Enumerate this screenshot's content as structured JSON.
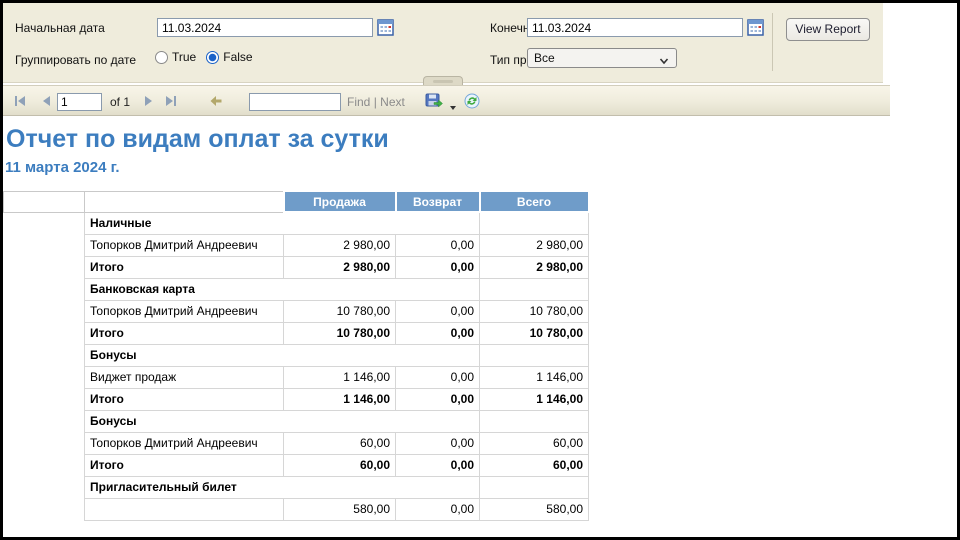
{
  "parameters": {
    "start_date_label": "Начальная дата",
    "start_date_value": "11.03.2024",
    "end_date_label": "Конечная дата",
    "end_date_value": "11.03.2024",
    "group_by_date_label": "Группировать по дате",
    "radio_true_label": "True",
    "radio_false_label": "False",
    "radio_selected": "False",
    "rental_type_label": "Тип проката:",
    "rental_type_value": "Все",
    "view_report_label": "View Report"
  },
  "toolbar": {
    "page_value": "1",
    "of_label": "of 1",
    "find_value": "",
    "find_label": "Find",
    "separator": "|",
    "next_label": "Next"
  },
  "icons": {
    "calendar": "calendar-grid",
    "first_page": "bar-left-triangle",
    "prev_page": "left-triangle",
    "next_page": "right-triangle",
    "last_page": "right-triangle-bar",
    "back_parent": "left-arrow",
    "export": "floppy-disk-green-arrow",
    "export_caret": "down-caret",
    "refresh": "circular-green-arrows",
    "collapse": "up-handle",
    "dropdown_caret": "down-chevron"
  },
  "report": {
    "title": "Отчет по видам оплат за сутки",
    "subtitle": "11 марта 2024 г."
  },
  "table": {
    "columns": [
      "Продажа",
      "Возврат",
      "Всего"
    ],
    "rows": [
      {
        "type": "group",
        "name": "Наличные"
      },
      {
        "type": "detail",
        "name": "Топорков Дмитрий Андреевич",
        "sale": "2 980,00",
        "refund": "0,00",
        "total": "2 980,00"
      },
      {
        "type": "total",
        "name": "Итого",
        "sale": "2 980,00",
        "refund": "0,00",
        "total": "2 980,00"
      },
      {
        "type": "group",
        "name": "Банковская карта"
      },
      {
        "type": "detail",
        "name": "Топорков Дмитрий Андреевич",
        "sale": "10 780,00",
        "refund": "0,00",
        "total": "10 780,00"
      },
      {
        "type": "total",
        "name": "Итого",
        "sale": "10 780,00",
        "refund": "0,00",
        "total": "10 780,00"
      },
      {
        "type": "group",
        "name": "Бонусы"
      },
      {
        "type": "detail",
        "name": "Виджет продаж",
        "sale": "1 146,00",
        "refund": "0,00",
        "total": "1 146,00"
      },
      {
        "type": "total",
        "name": "Итого",
        "sale": "1 146,00",
        "refund": "0,00",
        "total": "1 146,00"
      },
      {
        "type": "group",
        "name": "Бонусы"
      },
      {
        "type": "detail",
        "name": "Топорков Дмитрий Андреевич",
        "sale": "60,00",
        "refund": "0,00",
        "total": "60,00"
      },
      {
        "type": "total",
        "name": "Итого",
        "sale": "60,00",
        "refund": "0,00",
        "total": "60,00"
      },
      {
        "type": "group",
        "name": "Пригласительный билет"
      },
      {
        "type": "detail",
        "name": "",
        "sale": "580,00",
        "refund": "0,00",
        "total": "580,00"
      }
    ]
  },
  "colors": {
    "panel_bg": "#EFECDC",
    "header_blue": "#6F9CC9",
    "title_blue": "#3C7DBF",
    "border_black": "#000000",
    "grid_gray": "#D6D6D6",
    "radio_selected_blue": "#1A62C8"
  }
}
